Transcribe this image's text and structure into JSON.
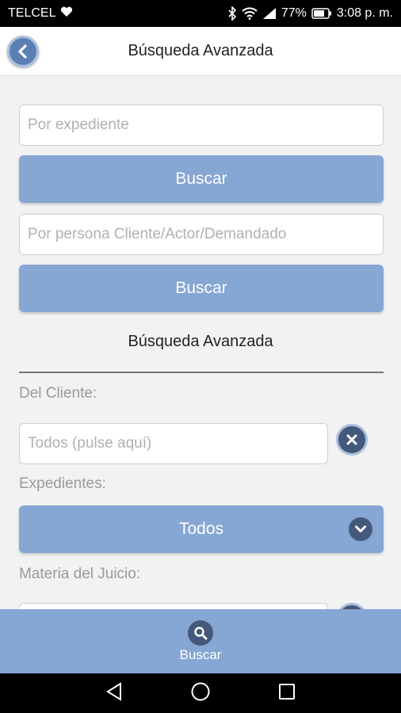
{
  "status_bar": {
    "carrier": "TELCEL",
    "battery": "77%",
    "time": "3:08 p. m."
  },
  "header": {
    "title": "Búsqueda Avanzada"
  },
  "search": {
    "expediente_placeholder": "Por expediente",
    "expediente_button": "Buscar",
    "persona_placeholder": "Por persona Cliente/Actor/Demandado",
    "persona_button": "Buscar"
  },
  "advanced": {
    "title": "Búsqueda Avanzada",
    "cliente_label": "Del Cliente:",
    "cliente_placeholder": "Todos (pulse aquí)",
    "expedientes_label": "Expedientes:",
    "expedientes_value": "Todos",
    "materia_label": "Materia del Juicio:"
  },
  "bottom_bar": {
    "label": "Buscar"
  },
  "colors": {
    "accent": "#86a6d4",
    "dark_accent": "#44597a"
  }
}
